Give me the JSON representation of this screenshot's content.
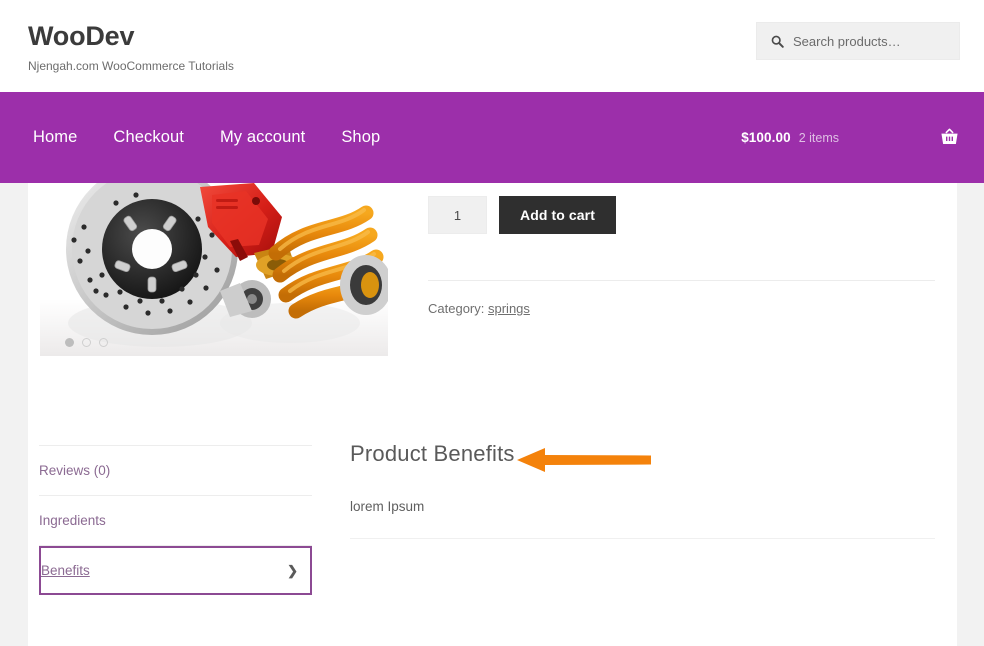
{
  "header": {
    "site_title": "WooDev",
    "tagline": "Njengah.com WooCommerce Tutorials",
    "search": {
      "icon": "search-icon",
      "value": "",
      "placeholder": "Search products…"
    }
  },
  "nav": {
    "background_color": "#9c2faa",
    "links": [
      {
        "label": "Home"
      },
      {
        "label": "Checkout"
      },
      {
        "label": "My account"
      },
      {
        "label": "Shop"
      }
    ],
    "cart": {
      "total": "$100.00",
      "count": "2 items",
      "icon": "shopping-basket-icon"
    }
  },
  "product": {
    "gallery": {
      "image_alt": "Brake disc with red caliper and orange coil spring",
      "dots": 3,
      "active_dot": 1
    },
    "quantity": "1",
    "add_to_cart_label": "Add to cart",
    "meta": {
      "category_label": "Category:",
      "category_value": "springs"
    }
  },
  "tabs": {
    "items": [
      {
        "label": "Reviews (0)",
        "active": false
      },
      {
        "label": "Ingredients",
        "active": false
      },
      {
        "label": "Benefits",
        "active": true,
        "chevron": "chevron-right-icon"
      }
    ],
    "active_border_color": "#8c4a93"
  },
  "panel": {
    "title": "Product Benefits",
    "body": "lorem Ipsum"
  },
  "annotation": {
    "arrow_color": "#f4820b",
    "direction": "left"
  }
}
